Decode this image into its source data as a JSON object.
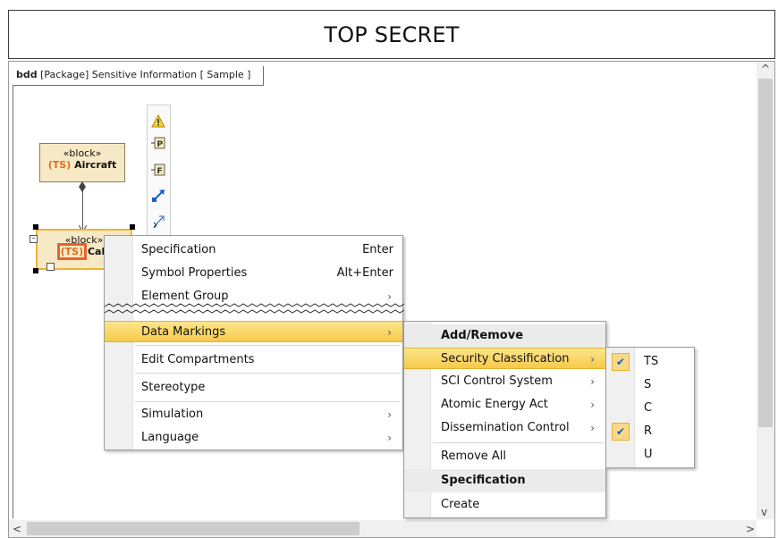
{
  "banner": {
    "title": "TOP SECRET"
  },
  "diagram": {
    "tab_kind": "bdd",
    "tab_rest": "[Package] Sensitive Information [ Sample ]"
  },
  "blocks": {
    "aircraft": {
      "stereotype": "«block»",
      "marking": "(TS)",
      "name": "Aircraft"
    },
    "cabin": {
      "stereotype": "«block»",
      "marking": "(TS)",
      "name": "Cab"
    }
  },
  "toolbar_icons": [
    "warning-icon",
    "port-icon",
    "flow-port-icon",
    "generalization-icon",
    "composition-icon"
  ],
  "context_menu": {
    "items": [
      {
        "label": "Specification",
        "shortcut": "Enter"
      },
      {
        "label": "Symbol Properties",
        "shortcut": "Alt+Enter"
      },
      {
        "label": "Element Group",
        "submenu": "›"
      },
      {
        "label": "Data Markings",
        "submenu": "›"
      },
      {
        "label": "Edit Compartments"
      },
      {
        "label": "Stereotype"
      },
      {
        "label": "Simulation",
        "submenu": "›"
      },
      {
        "label": "Language",
        "submenu": "›"
      }
    ]
  },
  "data_markings_menu": {
    "header": "Add/Remove",
    "items": [
      {
        "label": "Security Classification",
        "submenu": "›"
      },
      {
        "label": "SCI Control System",
        "submenu": "›"
      },
      {
        "label": "Atomic Energy Act",
        "submenu": "›"
      },
      {
        "label": "Dissemination Control",
        "submenu": "›"
      },
      {
        "label": "Remove All"
      }
    ],
    "spec_header": "Specification",
    "create": "Create"
  },
  "classification_menu": {
    "items": [
      {
        "label": "TS",
        "checked": true
      },
      {
        "label": "S",
        "checked": false
      },
      {
        "label": "C",
        "checked": false
      },
      {
        "label": "R",
        "checked": true
      },
      {
        "label": "U",
        "checked": false
      }
    ],
    "check_glyph": "✔"
  },
  "scroll": {
    "up": "^",
    "down": "v",
    "left": "<",
    "right": ">"
  },
  "colors": {
    "highlight": "#f6c94a",
    "marking": "#e06c1a",
    "block_fill": "#f7e9c5"
  }
}
